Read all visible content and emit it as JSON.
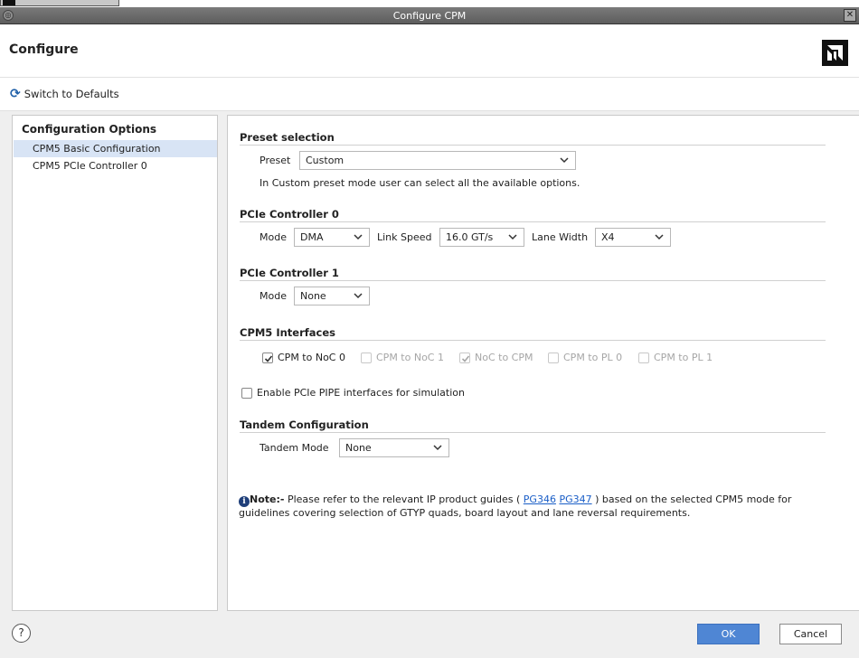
{
  "window": {
    "title": "Configure CPM",
    "menu_glyph": "◎",
    "close_glyph": "✕"
  },
  "header": {
    "title": "Configure",
    "logo": "amd-logo"
  },
  "toolbar": {
    "switch_label": "Switch to Defaults",
    "switch_icon": "refresh-icon"
  },
  "sidebar": {
    "title": "Configuration Options",
    "items": [
      {
        "label": "CPM5 Basic Configuration",
        "selected": true
      },
      {
        "label": "CPM5 PCIe Controller 0",
        "selected": false
      }
    ]
  },
  "preset": {
    "section": "Preset selection",
    "label": "Preset",
    "value": "Custom",
    "hint": "In Custom preset mode user can select all the available options."
  },
  "pcie0": {
    "section": "PCIe Controller 0",
    "mode_label": "Mode",
    "mode_value": "DMA",
    "speed_label": "Link Speed",
    "speed_value": "16.0 GT/s",
    "width_label": "Lane Width",
    "width_value": "X4"
  },
  "pcie1": {
    "section": "PCIe Controller 1",
    "mode_label": "Mode",
    "mode_value": "None"
  },
  "interfaces": {
    "section": "CPM5 Interfaces",
    "items": [
      {
        "label": "CPM to NoC 0",
        "checked": true,
        "enabled": true
      },
      {
        "label": "CPM to NoC 1",
        "checked": false,
        "enabled": false
      },
      {
        "label": "NoC to CPM",
        "checked": true,
        "enabled": false
      },
      {
        "label": "CPM to PL 0",
        "checked": false,
        "enabled": false
      },
      {
        "label": "CPM to PL 1",
        "checked": false,
        "enabled": false
      }
    ],
    "pipe_label": "Enable PCIe PIPE interfaces for simulation",
    "pipe_checked": false
  },
  "tandem": {
    "section": "Tandem Configuration",
    "label": "Tandem Mode",
    "value": "None"
  },
  "note": {
    "bold": "Note:-",
    "text1": " Please refer to the relevant IP product guides ( ",
    "link1": "PG346",
    "link2": "PG347",
    "text2": " ) based on the selected CPM5 mode for guidelines covering selection of GTYP quads, board layout and lane reversal requirements.",
    "icon_glyph": "i"
  },
  "footer": {
    "help_glyph": "?",
    "ok_label": "OK",
    "cancel_label": "Cancel"
  },
  "colors": {
    "accent": "#4f86d4",
    "selected_row": "#d8e4f5",
    "link": "#1a5ec7",
    "titlebar": "#6b6b6b"
  }
}
